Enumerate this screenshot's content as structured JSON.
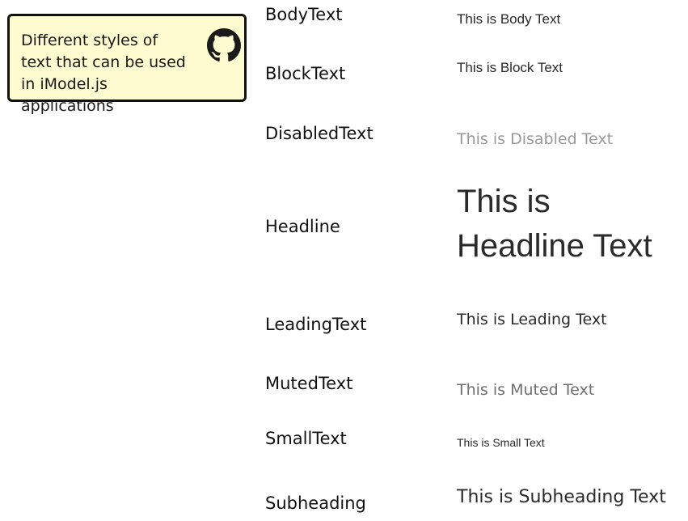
{
  "info_card": {
    "description": "Different styles of text that can be used in iModel.js applications",
    "icon": "github-icon"
  },
  "text_styles": [
    {
      "label": "BodyText",
      "sample": "This is Body Text"
    },
    {
      "label": "BlockText",
      "sample": "This is Block Text"
    },
    {
      "label": "DisabledText",
      "sample": "This is Disabled Text"
    },
    {
      "label": "Headline",
      "sample": "This is Headline Text"
    },
    {
      "label": "LeadingText",
      "sample": "This is Leading Text"
    },
    {
      "label": "MutedText",
      "sample": "This is Muted Text"
    },
    {
      "label": "SmallText",
      "sample": "This is Small Text"
    },
    {
      "label": "Subheading",
      "sample": "This is Subheading Text"
    }
  ],
  "colors": {
    "card_background": "#fffbd0",
    "card_border": "#111111",
    "disabled_text": "#9a9a9a",
    "muted_text": "#6f6f6f"
  }
}
